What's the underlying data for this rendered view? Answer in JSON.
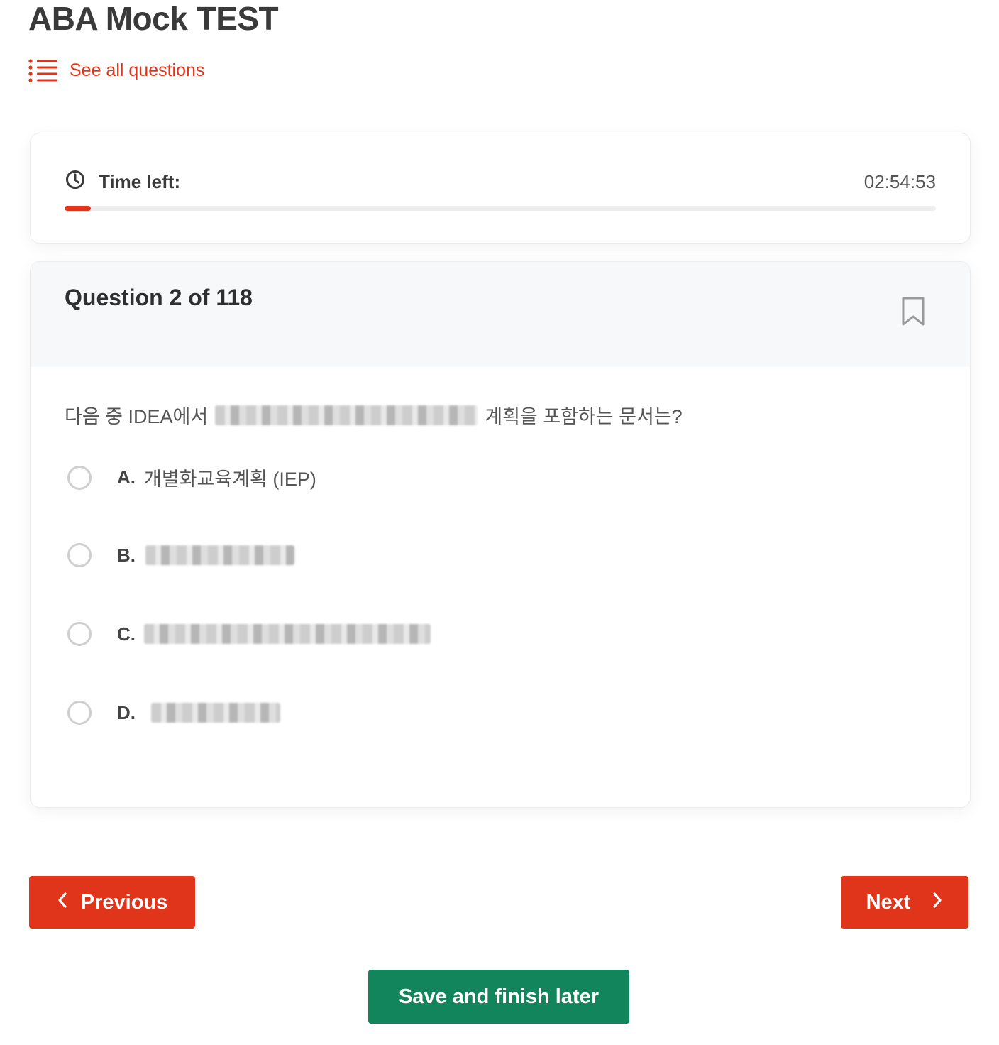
{
  "page": {
    "title": "ABA Mock TEST"
  },
  "nav": {
    "see_all_label": "See all questions"
  },
  "timer": {
    "label": "Time left:",
    "value": "02:54:53",
    "progress_fraction": 0.03
  },
  "question": {
    "number_label": "Question 2 of 118",
    "text_prefix": "다음 중 IDEA에서",
    "text_suffix": "계획을 포함하는 문서는?",
    "options": [
      {
        "letter": "A.",
        "text": "개별화교육계획 (IEP)"
      },
      {
        "letter": "B.",
        "text": ""
      },
      {
        "letter": "C.",
        "text": ""
      },
      {
        "letter": "D.",
        "text": ""
      }
    ]
  },
  "buttons": {
    "previous_label": "Previous",
    "next_label": "Next",
    "save_label": "Save and finish later"
  },
  "colors": {
    "accent": "#e0351a",
    "save": "#13855d"
  },
  "icons": {
    "list": "list-icon",
    "clock": "clock-icon",
    "bookmark": "bookmark-icon",
    "prev": "chevron-left-icon",
    "next": "chevron-right-icon"
  }
}
